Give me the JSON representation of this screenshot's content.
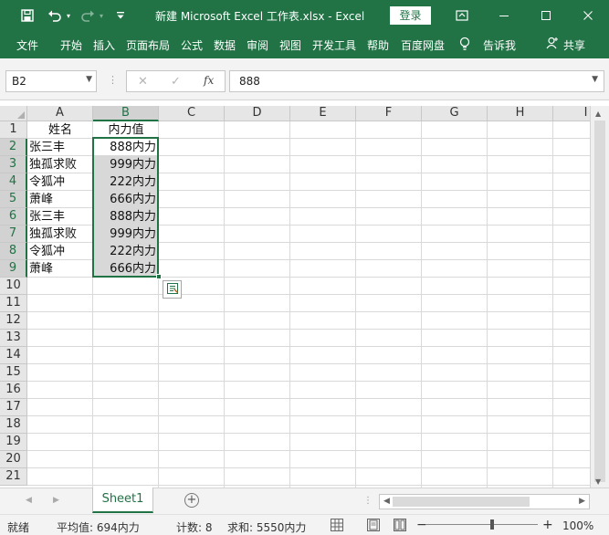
{
  "window": {
    "title": "新建 Microsoft Excel 工作表.xlsx  -  Excel",
    "login_label": "登录",
    "icons": [
      "save-icon",
      "undo-icon",
      "redo-icon",
      "customize-qat-icon",
      "ribbon-display-icon",
      "minimize-icon",
      "maximize-icon",
      "close-icon"
    ]
  },
  "ribbon": {
    "tabs": [
      "文件",
      "开始",
      "插入",
      "页面布局",
      "公式",
      "数据",
      "审阅",
      "视图",
      "开发工具",
      "帮助",
      "百度网盘"
    ],
    "tell_me": "告诉我",
    "share": "共享"
  },
  "formula_bar": {
    "name_box": "B2",
    "formula": "888",
    "cancel_glyph": "✕",
    "enter_glyph": "✓",
    "fx_label": "fx"
  },
  "sheet": {
    "columns": [
      "A",
      "B",
      "C",
      "D",
      "E",
      "F",
      "G",
      "H",
      "I"
    ],
    "selected_column": "B",
    "rows": [
      "1",
      "2",
      "3",
      "4",
      "5",
      "6",
      "7",
      "8",
      "9",
      "10",
      "11",
      "12",
      "13",
      "14",
      "15",
      "16",
      "17",
      "18",
      "19",
      "20",
      "21"
    ],
    "header_row": {
      "a": "姓名",
      "b": "内力值"
    },
    "data": [
      {
        "a": "张三丰",
        "b": "888内力"
      },
      {
        "a": "独孤求败",
        "b": "999内力"
      },
      {
        "a": "令狐冲",
        "b": "222内力"
      },
      {
        "a": "萧峰",
        "b": "666内力"
      },
      {
        "a": "张三丰",
        "b": "888内力"
      },
      {
        "a": "独孤求败",
        "b": "999内力"
      },
      {
        "a": "令狐冲",
        "b": "222内力"
      },
      {
        "a": "萧峰",
        "b": "666内力"
      }
    ],
    "selection": "B2:B9",
    "accent_color": "#217346"
  },
  "sheet_tabs": {
    "tabs": [
      "Sheet1"
    ],
    "active": "Sheet1"
  },
  "status": {
    "mode": "就绪",
    "average": "平均值: 694内力",
    "count": "计数: 8",
    "sum": "求和: 5550内力",
    "zoom": "100%",
    "zoom_minus": "−",
    "zoom_plus": "+"
  }
}
